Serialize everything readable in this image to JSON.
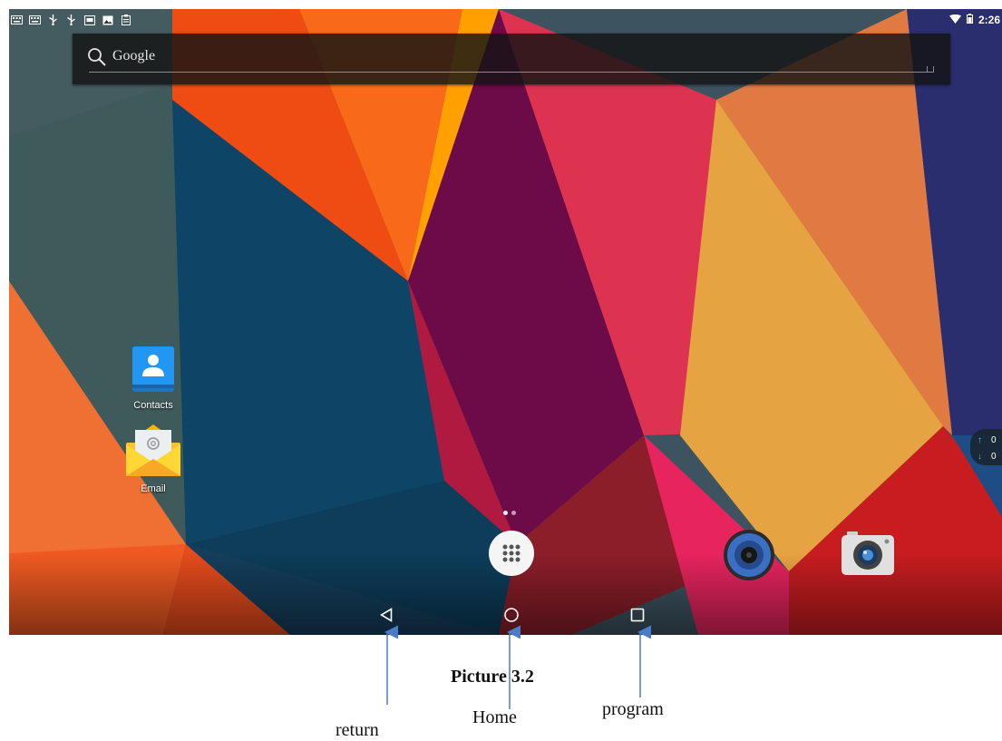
{
  "status_bar": {
    "notification_icons": [
      "keyboard-icon",
      "keyboard-icon",
      "usb-icon",
      "usb-icon",
      "sd-card-icon",
      "image-icon",
      "clipboard-icon"
    ],
    "clock": "2:26",
    "wifi_icon": "wifi-icon",
    "battery_icon": "battery-icon"
  },
  "search": {
    "placeholder": "Google",
    "icon": "search-icon"
  },
  "desktop": {
    "apps": [
      {
        "label": "Contacts",
        "icon": "contacts-icon"
      },
      {
        "label": "Email",
        "icon": "email-icon"
      }
    ]
  },
  "dock": {
    "items": [
      {
        "icon": "all-apps-icon"
      },
      {
        "icon": "music-icon"
      },
      {
        "icon": "camera-icon"
      }
    ]
  },
  "nav": {
    "buttons": [
      {
        "icon": "back-icon"
      },
      {
        "icon": "home-icon"
      },
      {
        "icon": "recents-icon"
      }
    ]
  },
  "side_widget": {
    "up": "0",
    "down": "0"
  },
  "caption": "Picture 3.2",
  "annotations": {
    "return": "return",
    "home": "Home",
    "program": "program"
  }
}
